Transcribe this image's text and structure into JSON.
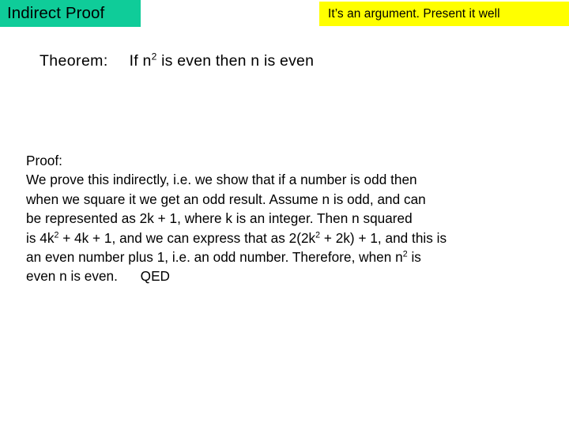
{
  "slide": {
    "title_banner": {
      "text": "Indirect Proof",
      "background_color": "#0FCC99",
      "text_color": "#000000"
    },
    "note_banner": {
      "text": "It’s an argument. Present it well",
      "background_color": "#FFFF00",
      "text_color": "#000000"
    },
    "theorem": {
      "label": "Theorem:",
      "statement_before_sup": "If n",
      "statement_sup": "2",
      "statement_after_sup": " is even then n is even"
    },
    "proof": {
      "heading": "Proof:",
      "lines": [
        {
          "id": "line-1",
          "segments": [
            {
              "type": "text",
              "value": "We prove this indirectly, i.e. we show that if a number is odd then"
            }
          ]
        },
        {
          "id": "line-2",
          "segments": [
            {
              "type": "text",
              "value": "when we square it we get an odd result. Assume n is odd, and can"
            }
          ]
        },
        {
          "id": "line-3",
          "segments": [
            {
              "type": "text",
              "value": "be represented as 2k + 1, where k is an integer. Then n squared"
            }
          ]
        },
        {
          "id": "line-4",
          "segments": [
            {
              "type": "text",
              "value": "is 4k"
            },
            {
              "type": "sup",
              "value": "2"
            },
            {
              "type": "text",
              "value": " + 4k + 1, and we can express that as 2(2k"
            },
            {
              "type": "sup",
              "value": "2"
            },
            {
              "type": "text",
              "value": " + 2k) + 1, and this is"
            }
          ]
        },
        {
          "id": "line-5",
          "segments": [
            {
              "type": "text",
              "value": "an even number plus 1, i.e. an odd number. Therefore, when n"
            },
            {
              "type": "sup",
              "value": "2"
            },
            {
              "type": "text",
              "value": " is"
            }
          ]
        },
        {
          "id": "line-6",
          "segments": [
            {
              "type": "text",
              "value": "even n is even.      QED"
            }
          ]
        }
      ]
    }
  }
}
